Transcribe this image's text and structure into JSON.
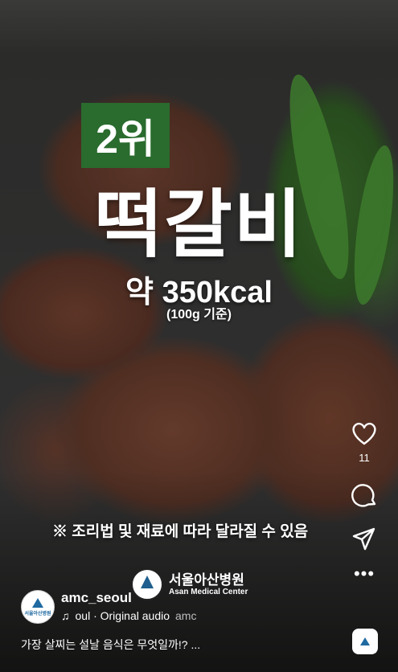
{
  "overlay": {
    "rank": "2위",
    "dish": "떡갈비",
    "calories": "약 350kcal",
    "basis": "(100g 기준)",
    "note": "※ 조리법 및 재료에 따라 달라질 수 있음"
  },
  "watermark": {
    "name_ko": "서울아산병원",
    "name_en": "Asan Medical Center"
  },
  "actions": {
    "like_count": "11",
    "icons": [
      "heart-icon",
      "comment-icon",
      "share-icon",
      "more-icon"
    ]
  },
  "account": {
    "handle": "amc_seoul",
    "avatar_text": "서울아산병원",
    "audio_prefix": "oul · Original audio",
    "audio_trail": "amc"
  },
  "caption": "가장 살찌는 설날 음식은 무엇일까!? ...",
  "colors": {
    "rank_bg": "#2a6b2e",
    "brand_blue": "#1f6aa1"
  }
}
